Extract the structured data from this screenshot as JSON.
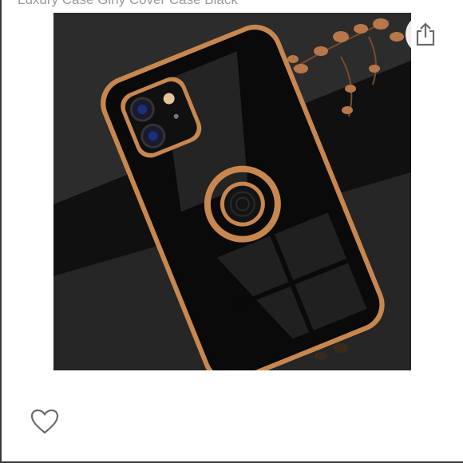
{
  "product": {
    "title": "Luxury Case Girly Cover Case Black",
    "image_alt": "Black phone case with gold edges and ring holder"
  },
  "icons": {
    "share": "share-icon",
    "favorite": "heart-outline-icon"
  },
  "colors": {
    "case_black": "#0a0a0a",
    "gold_trim": "#c8874e",
    "background_dark": "#2b2b2b",
    "icon_gray": "#6b6b6b"
  }
}
